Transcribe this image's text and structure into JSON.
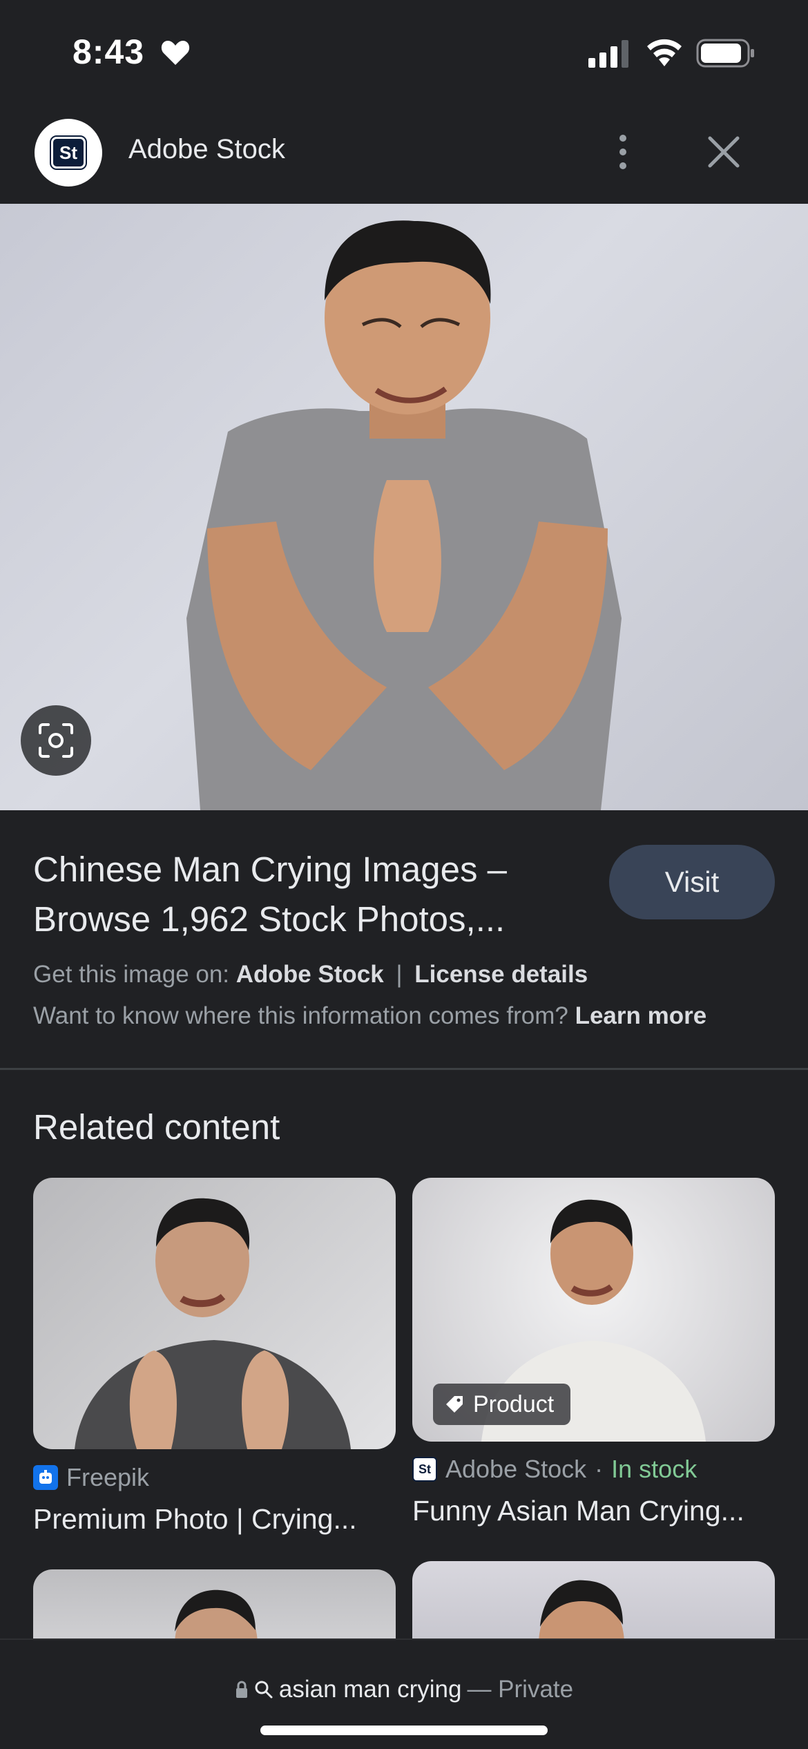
{
  "status_bar": {
    "time": "8:43"
  },
  "top_bar": {
    "logo_text": "St",
    "title": "Adobe Stock"
  },
  "result": {
    "title": "Chinese Man Crying Images – Browse 1,962 Stock Photos,...",
    "visit_label": "Visit",
    "get_image_prefix": "Get this image on:",
    "get_image_source": "Adobe Stock",
    "separator": "|",
    "license_details": "License details",
    "info_question": "Want to know where this information comes from?",
    "learn_more": "Learn more"
  },
  "related": {
    "heading": "Related content",
    "cards": [
      {
        "source": "Freepik",
        "caption": "Premium Photo | Crying..."
      },
      {
        "chip": "Product",
        "source": "Adobe Stock",
        "source_dot": "·",
        "stock": "In stock",
        "favicon_text": "St",
        "caption": "Funny Asian Man Crying..."
      }
    ]
  },
  "bottom_bar": {
    "query": "asian man crying",
    "private_label": "— Private"
  },
  "colors": {
    "background": "#202124",
    "visit_button": "#394457",
    "in_stock": "#81c995",
    "freepik": "#1273eb"
  }
}
